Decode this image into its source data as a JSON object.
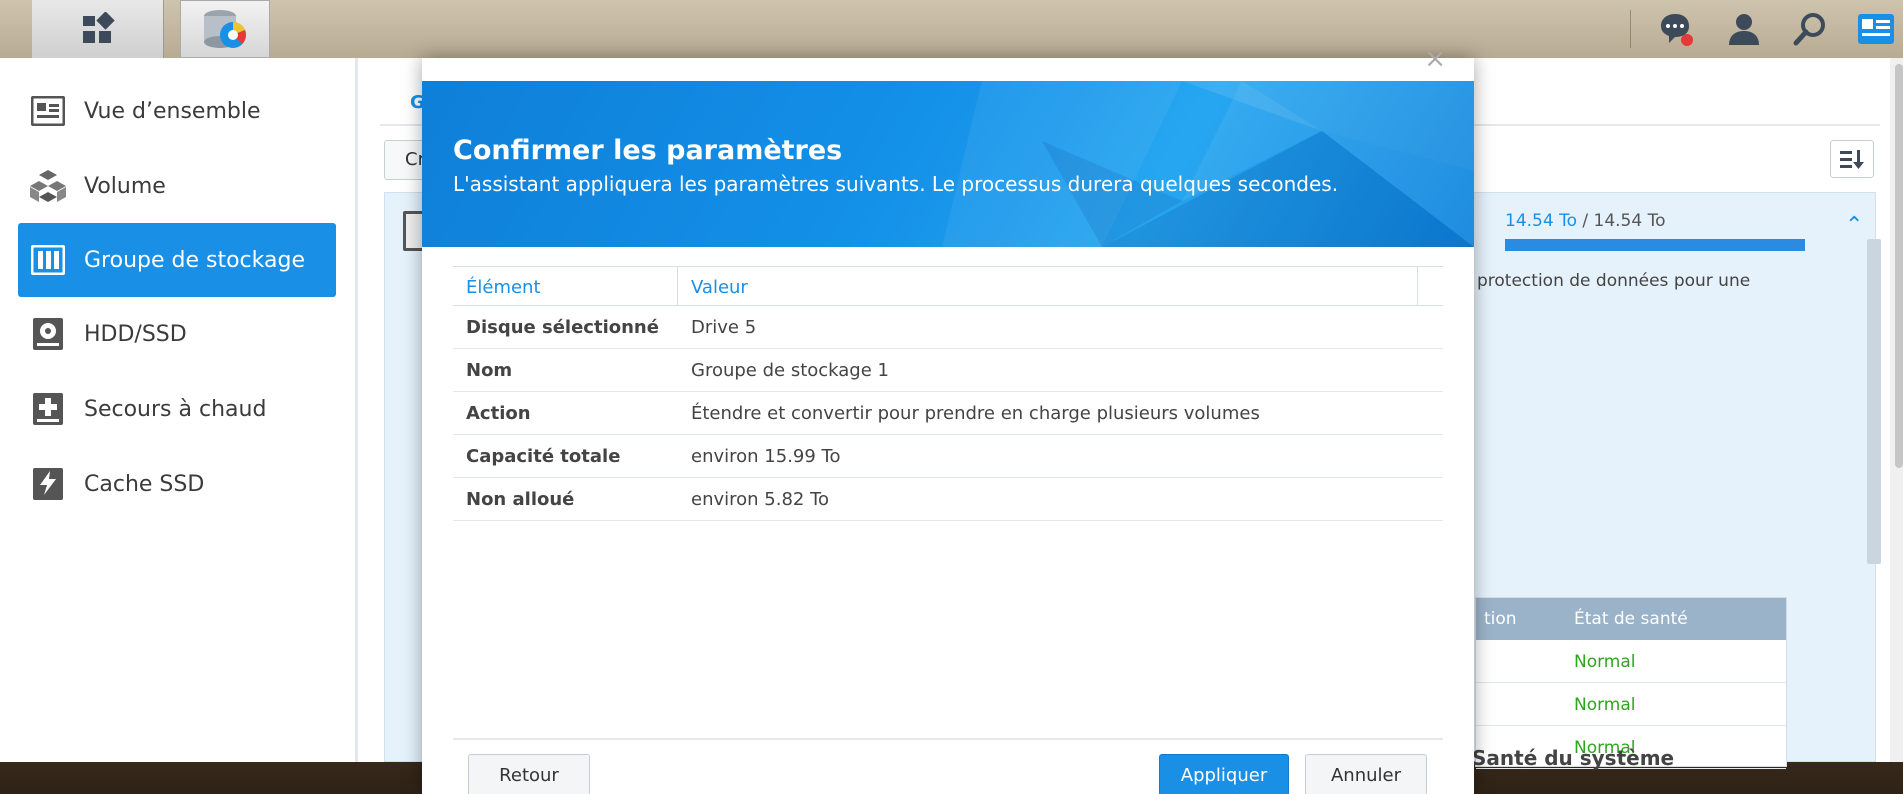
{
  "sidebar": {
    "items": [
      {
        "label": "Vue d’ensemble",
        "icon": "overview-icon"
      },
      {
        "label": "Volume",
        "icon": "volume-icon"
      },
      {
        "label": "Groupe de stockage",
        "icon": "storage-pool-icon"
      },
      {
        "label": "HDD/SSD",
        "icon": "hdd-icon"
      },
      {
        "label": "Secours à chaud",
        "icon": "hot-spare-icon"
      },
      {
        "label": "Cache SSD",
        "icon": "ssd-cache-icon"
      }
    ],
    "active_index": 2
  },
  "main": {
    "tab_partial": "G",
    "create_partial": "Cr",
    "capacity_used": "14.54 To",
    "capacity_sep": " / ",
    "capacity_total": "14.54 To",
    "capacity_fraction": 1.0,
    "description_partial": "protection de données pour une",
    "disk_table": {
      "col_partial": "tion",
      "col_health": "État de santé",
      "rows": [
        "Normal",
        "Normal",
        "Normal"
      ]
    },
    "health_title": "Santé du système"
  },
  "dialog": {
    "title": "Confirmer les paramètres",
    "subtitle": "L'assistant appliquera les paramètres suivants. Le processus durera quelques secondes.",
    "columns": [
      "Élément",
      "Valeur"
    ],
    "rows": [
      {
        "key": "Disque sélectionné",
        "value": "Drive 5"
      },
      {
        "key": "Nom",
        "value": "Groupe de stockage 1"
      },
      {
        "key": "Action",
        "value": "Étendre et convertir pour prendre en charge plusieurs volumes"
      },
      {
        "key": "Capacité totale",
        "value": "environ 15.99 To"
      },
      {
        "key": "Non alloué",
        "value": "environ 5.82 To"
      }
    ],
    "buttons": {
      "back": "Retour",
      "apply": "Appliquer",
      "cancel": "Annuler"
    }
  },
  "colors": {
    "accent": "#1a8fe6",
    "healthy": "#2fa51f",
    "notification": "#e53935"
  }
}
